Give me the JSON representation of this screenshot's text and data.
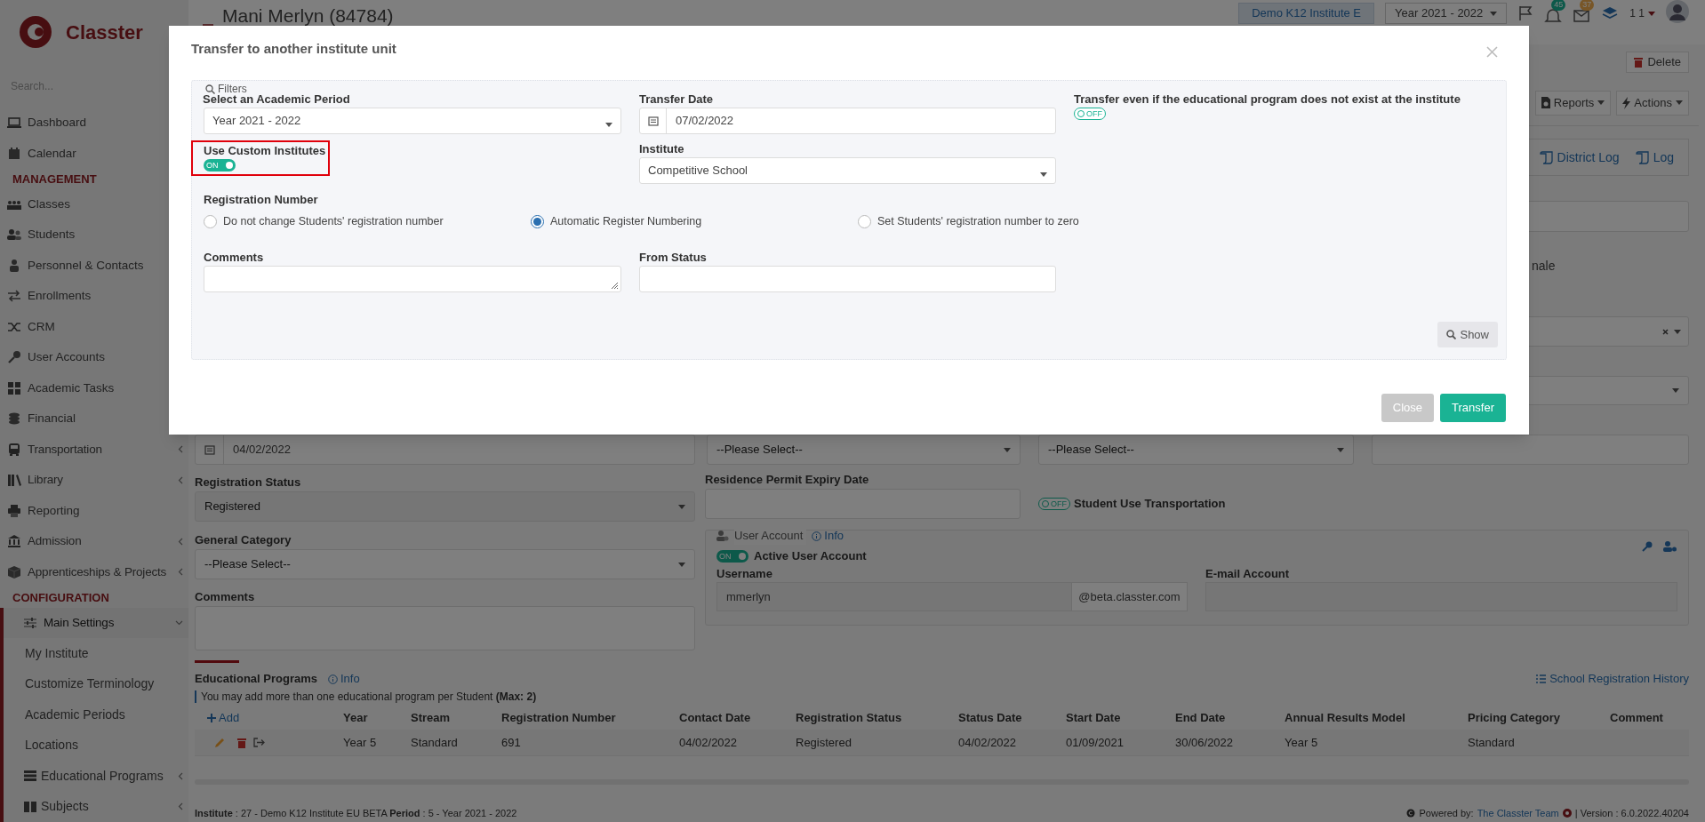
{
  "sidebar": {
    "brand": "Classter",
    "search_placeholder": "Search...",
    "items": [
      {
        "kind": "link",
        "label": "Dashboard",
        "selected": false
      },
      {
        "kind": "link",
        "label": "Calendar",
        "selected": false
      },
      {
        "kind": "heading",
        "label": "MANAGEMENT"
      },
      {
        "kind": "link",
        "label": "Classes",
        "selected": false
      },
      {
        "kind": "link",
        "label": "Students",
        "selected": false
      },
      {
        "kind": "link",
        "label": "Personnel & Contacts",
        "selected": false
      },
      {
        "kind": "link",
        "label": "Enrollments",
        "selected": false
      },
      {
        "kind": "link",
        "label": "CRM",
        "selected": false
      },
      {
        "kind": "link",
        "label": "User Accounts",
        "selected": false
      },
      {
        "kind": "link",
        "label": "Academic Tasks",
        "selected": false
      },
      {
        "kind": "link",
        "label": "Financial",
        "selected": false
      },
      {
        "kind": "link",
        "label": "Transportation",
        "selected": false,
        "expanded": false
      },
      {
        "kind": "link",
        "label": "Library",
        "selected": false,
        "expanded": false
      },
      {
        "kind": "link",
        "label": "Reporting",
        "selected": false
      },
      {
        "kind": "link",
        "label": "Admission",
        "selected": false,
        "expanded": false
      },
      {
        "kind": "link",
        "label": "Apprenticeships & Projects",
        "selected": false,
        "expanded": false
      },
      {
        "kind": "heading",
        "label": "CONFIGURATION"
      },
      {
        "kind": "link",
        "label": "Main Settings",
        "selected": true,
        "expanded": true,
        "children": [
          {
            "label": "My Institute",
            "selected": false
          },
          {
            "label": "Customize Terminology",
            "selected": false
          },
          {
            "label": "Academic Periods",
            "selected": false
          },
          {
            "label": "Locations",
            "selected": false
          },
          {
            "label": "Educational Programs",
            "selected": false,
            "expanded": false
          },
          {
            "label": "Subjects",
            "selected": false,
            "expanded": false
          }
        ]
      }
    ]
  },
  "header": {
    "title": "Mani Merlyn (84784)",
    "institute": "Demo K12 Institute E",
    "period": "Year 2021 - 2022",
    "notifications": "45",
    "messages": "37",
    "user": "1 1"
  },
  "toolbar": {
    "delete": "Delete",
    "reports": "Reports",
    "actions": "Actions",
    "district_log": "District Log",
    "log": "Log"
  },
  "right_column": {
    "partial_label": "nale"
  },
  "form": {
    "admission_date": "04/02/2022",
    "select_2": "--Please Select--",
    "select_3": "--Please Select--",
    "registration_status": {
      "label": "Registration Status",
      "value": "Registered"
    },
    "residence_permit": {
      "label": "Residence Permit Expiry Date"
    },
    "transportation": {
      "label": "Student Use Transportation",
      "toggle": {
        "on": false,
        "text": "OFF"
      }
    },
    "general_category": {
      "label": "General Category",
      "value": "--Please Select--"
    },
    "comments": {
      "label": "Comments"
    },
    "user_account": {
      "title": "User Account",
      "info": "Info",
      "active": {
        "label": "Active User Account",
        "toggle": {
          "on": true,
          "text": "ON"
        }
      },
      "username_label": "Username",
      "username": "mmerlyn",
      "domain": "@beta.classter.com",
      "email_label": "E-mail Account"
    }
  },
  "educational_programs": {
    "title": "Educational Programs",
    "info": "Info",
    "history_link": "School Registration History",
    "note": "You may add more than one educational program per Student **(Max: 2)**",
    "add": "Add",
    "columns": [
      "Year",
      "Stream",
      "Registration Number",
      "Contact Date",
      "Registration Status",
      "Status Date",
      "Start Date",
      "End Date",
      "Annual Results Model",
      "Pricing Category",
      "Comment"
    ],
    "rows": [
      {
        "cells": [
          "Year 5",
          "Standard",
          "691",
          "04/02/2022",
          "Registered",
          "04/02/2022",
          "01/09/2021",
          "30/06/2022",
          "Year 5",
          "Standard"
        ]
      }
    ]
  },
  "footer": {
    "info": "**Institute** : 27 - Demo K12 Institute EU BETA **Period** : 5 - Year 2021 - 2022",
    "powered": "Powered by:",
    "team": "The Classter Team",
    "version": "| Version : 6.0.2022.40204"
  },
  "modal": {
    "title": "Transfer to another institute unit",
    "filters_label": "Filters",
    "academic_period": {
      "label": "Select an Academic Period",
      "value": "Year 2021 - 2022"
    },
    "transfer_date": {
      "label": "Transfer Date",
      "value": "07/02/2022"
    },
    "transfer_anyway": {
      "label": "Transfer even if the educational program does not exist at the institute",
      "toggle": {
        "on": false,
        "text": "OFF"
      }
    },
    "custom_institutes": {
      "label": "Use Custom Institutes",
      "highlighted": true,
      "toggle": {
        "on": true,
        "text": "ON"
      }
    },
    "institute": {
      "label": "Institute",
      "value": "Competitive School"
    },
    "registration_number": {
      "label": "Registration Number",
      "options": [
        {
          "label": "Do not change Students' registration number",
          "selected": false
        },
        {
          "label": "Automatic Register Numbering",
          "selected": true
        },
        {
          "label": "Set Students' registration number to zero",
          "selected": false
        }
      ]
    },
    "comments": {
      "label": "Comments"
    },
    "from_status": {
      "label": "From Status"
    },
    "show": "Show",
    "buttons": [
      {
        "label": "Close",
        "kind": "secondary"
      },
      {
        "label": "Transfer",
        "kind": "primary"
      }
    ]
  }
}
